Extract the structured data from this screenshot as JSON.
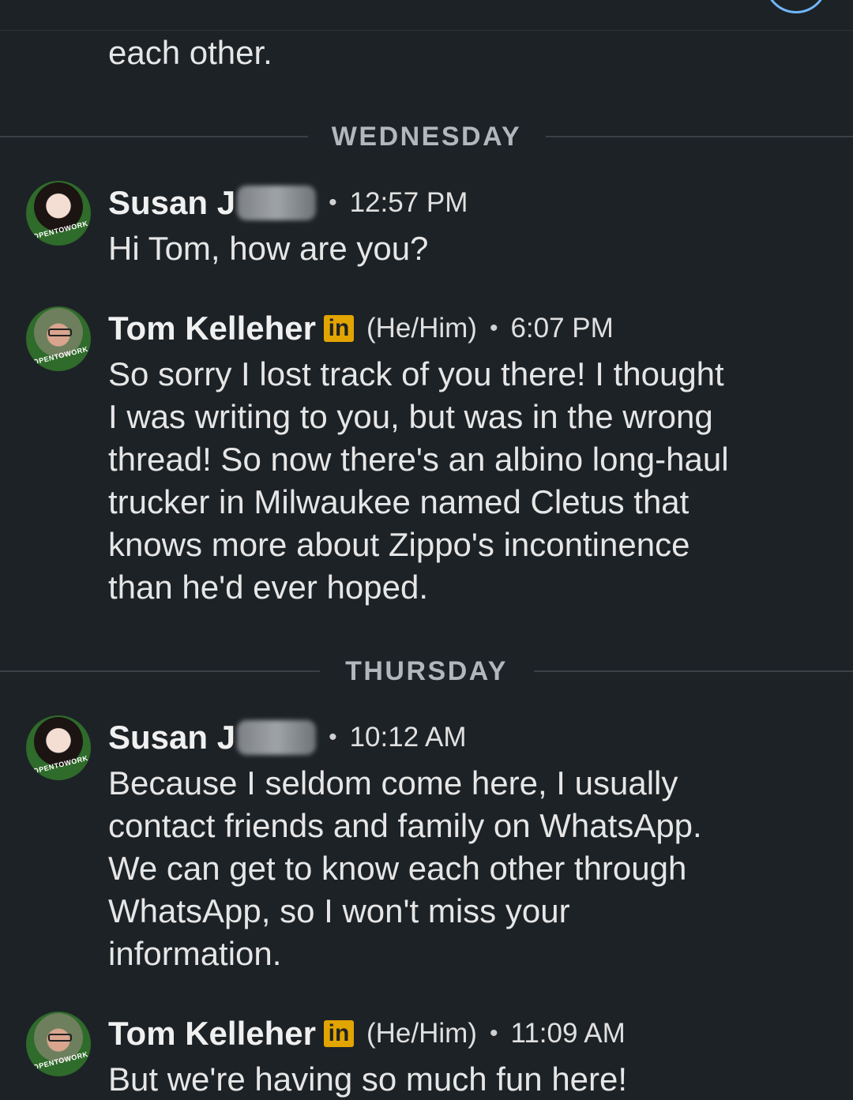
{
  "colors": {
    "background": "#1d2226",
    "text": "#e6e6e6",
    "divider": "#3a4046",
    "linkedin_badge": "#e2a400",
    "accent": "#70b5f9"
  },
  "continued_text": "each other.",
  "days": [
    {
      "label": "WEDNESDAY",
      "messages": [
        {
          "sender": "Susan J",
          "avatar_ring": "#OPENTOWORK",
          "time": "12:57 PM",
          "lines": [
            "Hi Tom, how are you?"
          ]
        },
        {
          "sender": "Tom Kelleher",
          "badge": "in",
          "pronouns": "(He/Him)",
          "avatar_ring": "#OPENTOWORK",
          "time": "6:07 PM",
          "lines": [
            "So sorry I lost track of you there!  I thought",
            "I was writing to you, but was in the wrong",
            "thread!  So now there's an albino long-haul",
            "trucker in Milwaukee named Cletus that",
            "knows more about Zippo's incontinence",
            "than he'd ever hoped."
          ]
        }
      ]
    },
    {
      "label": "THURSDAY",
      "messages": [
        {
          "sender": "Susan J",
          "avatar_ring": "#OPENTOWORK",
          "time": "10:12 AM",
          "lines": [
            "Because I seldom come here, I usually",
            "contact friends and family on WhatsApp.",
            "We can get to know each other through",
            "WhatsApp, so I won't miss your",
            "information."
          ]
        },
        {
          "sender": "Tom Kelleher",
          "badge": "in",
          "pronouns": "(He/Him)",
          "avatar_ring": "#OPENTOWORK",
          "time": "11:09 AM",
          "lines": [
            "But we're having so much fun here!"
          ]
        }
      ]
    }
  ]
}
